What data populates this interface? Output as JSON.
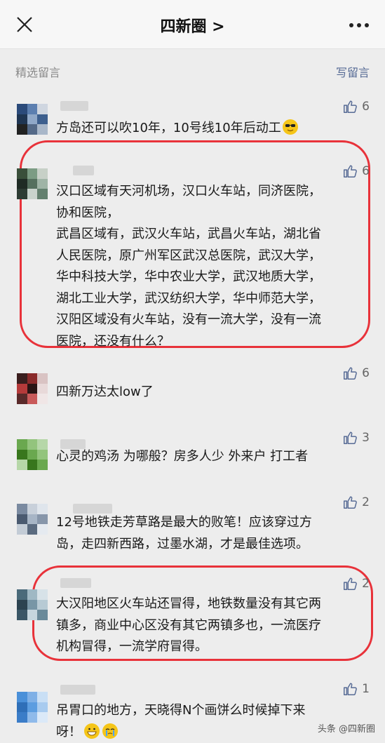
{
  "header": {
    "title": "四新圈 >",
    "close_icon": "close-icon",
    "more_icon": "more-icon"
  },
  "section": {
    "label": "精选留言",
    "write_label": "写留言"
  },
  "comments": [
    {
      "likes": "6",
      "text": "方岛还可以吹10年，10号线10年后动工"
    },
    {
      "likes": "6",
      "lines": [
        "汉口区域有天河机场，汉口火车站，同济医院，",
        "协和医院，",
        "武昌区域有，武汉火车站，武昌火车站，湖北省",
        "人民医院，原广州军区武汉总医院，武汉大学，",
        "华中科技大学，华中农业大学，武汉地质大学，",
        "湖北工业大学，武汉纺织大学，华中师范大学，",
        "汉阳区域没有火车站，没有一流大学，没有一流",
        "医院，还没有什么？"
      ]
    },
    {
      "likes": "6",
      "text": "四新万达太low了"
    },
    {
      "likes": "3",
      "text": "心灵的鸡汤 为哪般？房多人少 外来户 打工者"
    },
    {
      "likes": "2",
      "lines": [
        "12号地铁走芳草路是最大的败笔！应该穿过方",
        "岛，走四新西路，过墨水湖，才是最佳选项。"
      ]
    },
    {
      "likes": "2",
      "lines": [
        "大汉阳地区火车站还冒得，地铁数量没有其它两",
        "镇多，商业中心区没有其它两镇多也，一流医疗",
        "机构冒得，一流学府冒得。"
      ]
    },
    {
      "likes": "1",
      "lines": [
        "吊胃口的地方，天晓得N个画饼么时候掉下来",
        "呀！"
      ]
    }
  ],
  "watermark": "头条 @四新圈",
  "colors": {
    "link": "#576b95",
    "highlight": "#e8323a",
    "background": "#ededed"
  }
}
